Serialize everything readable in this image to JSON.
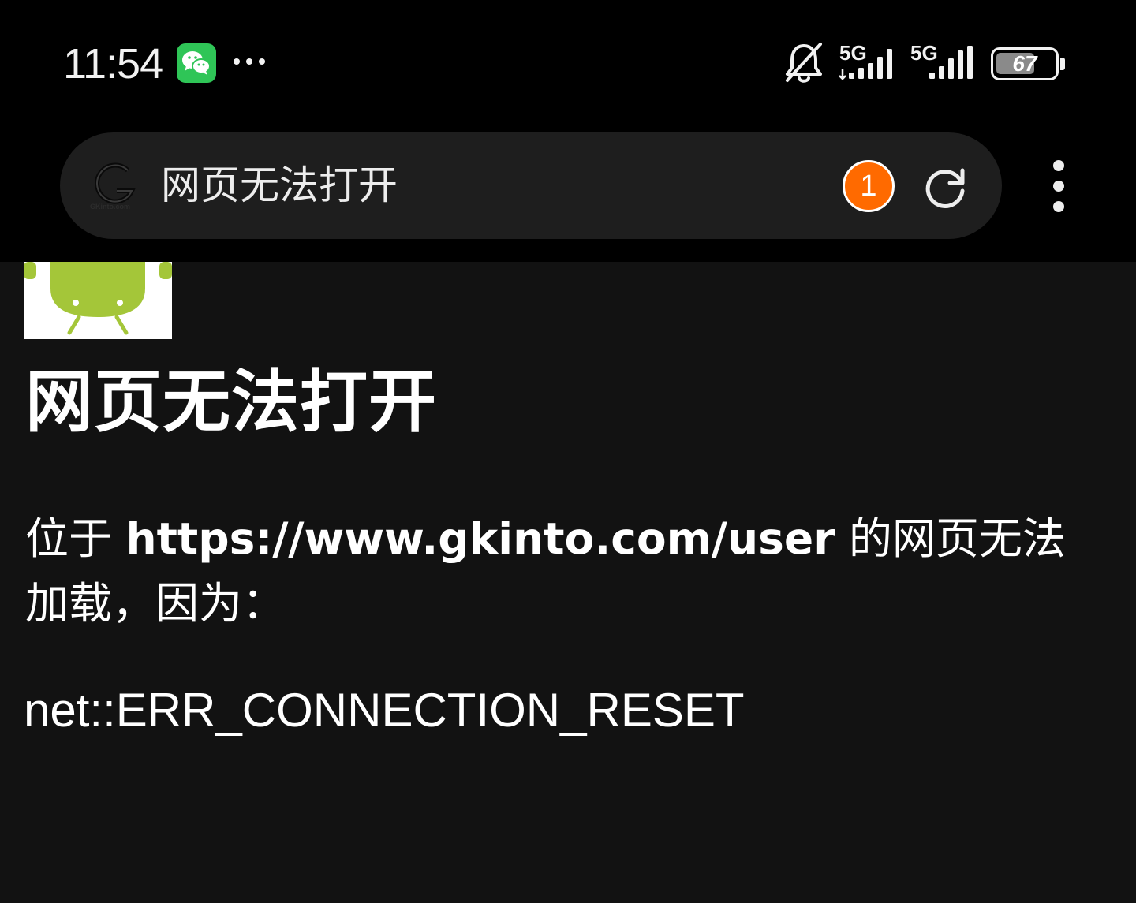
{
  "status_bar": {
    "time": "11:54",
    "notification_app_icon": "wechat-icon",
    "more_notifications_icon": "more-dots-icon",
    "mute_icon": "bell-off-icon",
    "sim1_network": "5G",
    "sim2_network": "5G",
    "battery_level": "67",
    "battery_fraction": 0.67
  },
  "browser": {
    "site_logo_icon": "gkinto-logo-icon",
    "site_logo_text": "GKinto.com",
    "page_title": "网页无法打开",
    "tab_count": "1",
    "reload_icon": "reload-icon",
    "menu_icon": "vertical-dots-menu-icon"
  },
  "page": {
    "error_image_icon": "android-robot-icon",
    "heading": "网页无法打开",
    "message_prefix": "位于 ",
    "url": "https://www.gkinto.com/user",
    "message_suffix": " 的网页无法加载，因为：",
    "error_code": "net::ERR_CONNECTION_RESET"
  },
  "colors": {
    "background": "#121212",
    "status_bar_bg": "#000000",
    "address_bar_bg": "#1e1e1e",
    "tab_badge": "#ff6a00",
    "wechat_green": "#2fc557",
    "android_green": "#a4c639"
  }
}
